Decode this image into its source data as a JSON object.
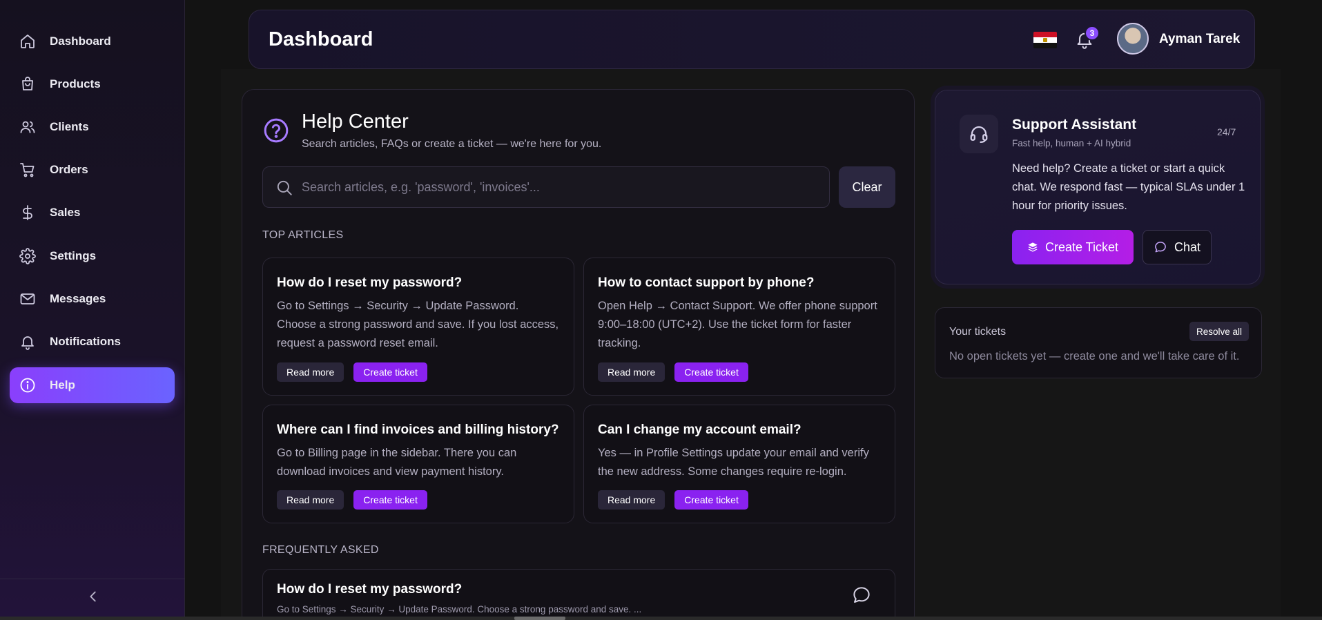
{
  "sidebar": {
    "items": [
      {
        "label": "Dashboard",
        "icon": "home-icon"
      },
      {
        "label": "Products",
        "icon": "shopping-bag-icon"
      },
      {
        "label": "Clients",
        "icon": "users-icon"
      },
      {
        "label": "Orders",
        "icon": "cart-icon"
      },
      {
        "label": "Sales",
        "icon": "dollar-icon"
      },
      {
        "label": "Settings",
        "icon": "gear-icon"
      },
      {
        "label": "Messages",
        "icon": "mail-icon"
      },
      {
        "label": "Notifications",
        "icon": "bell-icon"
      },
      {
        "label": "Help",
        "icon": "info-icon",
        "active": true
      }
    ],
    "collapse_icon": "chevron-left-icon"
  },
  "header": {
    "title": "Dashboard",
    "language_flag": "egypt-flag",
    "notifications_count": "3",
    "user_name": "Ayman Tarek"
  },
  "help": {
    "title": "Help Center",
    "subtitle": "Search articles, FAQs or create a ticket — we're here for you.",
    "search_placeholder": "Search articles, e.g. 'password', 'invoices'...",
    "search_value": "",
    "clear_label": "Clear",
    "top_articles_label": "TOP ARTICLES",
    "articles": [
      {
        "title": "How do I reset my password?",
        "text": "Go to Settings → Security → Update Password. Choose a strong password and save. If you lost access, request a password reset email.",
        "read_more": "Read more",
        "create_ticket": "Create ticket"
      },
      {
        "title": "How to contact support by phone?",
        "text": "Open Help → Contact Support. We offer phone support 9:00–18:00 (UTC+2). Use the ticket form for faster tracking.",
        "read_more": "Read more",
        "create_ticket": "Create ticket"
      },
      {
        "title": "Where can I find invoices and billing history?",
        "text": "Go to Billing page in the sidebar. There you can download invoices and view payment history.",
        "read_more": "Read more",
        "create_ticket": "Create ticket"
      },
      {
        "title": "Can I change my account email?",
        "text": "Yes — in Profile Settings update your email and verify the new address. Some changes require re-login.",
        "read_more": "Read more",
        "create_ticket": "Create ticket"
      }
    ],
    "faq_label": "FREQUENTLY ASKED",
    "faq": [
      {
        "question": "How do I reset my password?",
        "preview": "Go to Settings → Security → Update Password. Choose a strong password and save. ..."
      }
    ]
  },
  "support": {
    "title": "Support Assistant",
    "subtitle": "Fast help, human + AI hybrid",
    "badge": "24/7",
    "text": "Need help? Create a ticket or start a quick chat. We respond fast — typical SLAs under 1 hour for priority issues.",
    "create_ticket_label": "Create Ticket",
    "chat_label": "Chat"
  },
  "tickets": {
    "title": "Your tickets",
    "resolve_all_label": "Resolve all",
    "empty_text": "No open tickets yet — create one and we'll take care of it."
  },
  "colors": {
    "accent": "#8a22f0",
    "accent_gradient_end": "#6a63ff",
    "background": "#131313",
    "card": "#121016"
  }
}
